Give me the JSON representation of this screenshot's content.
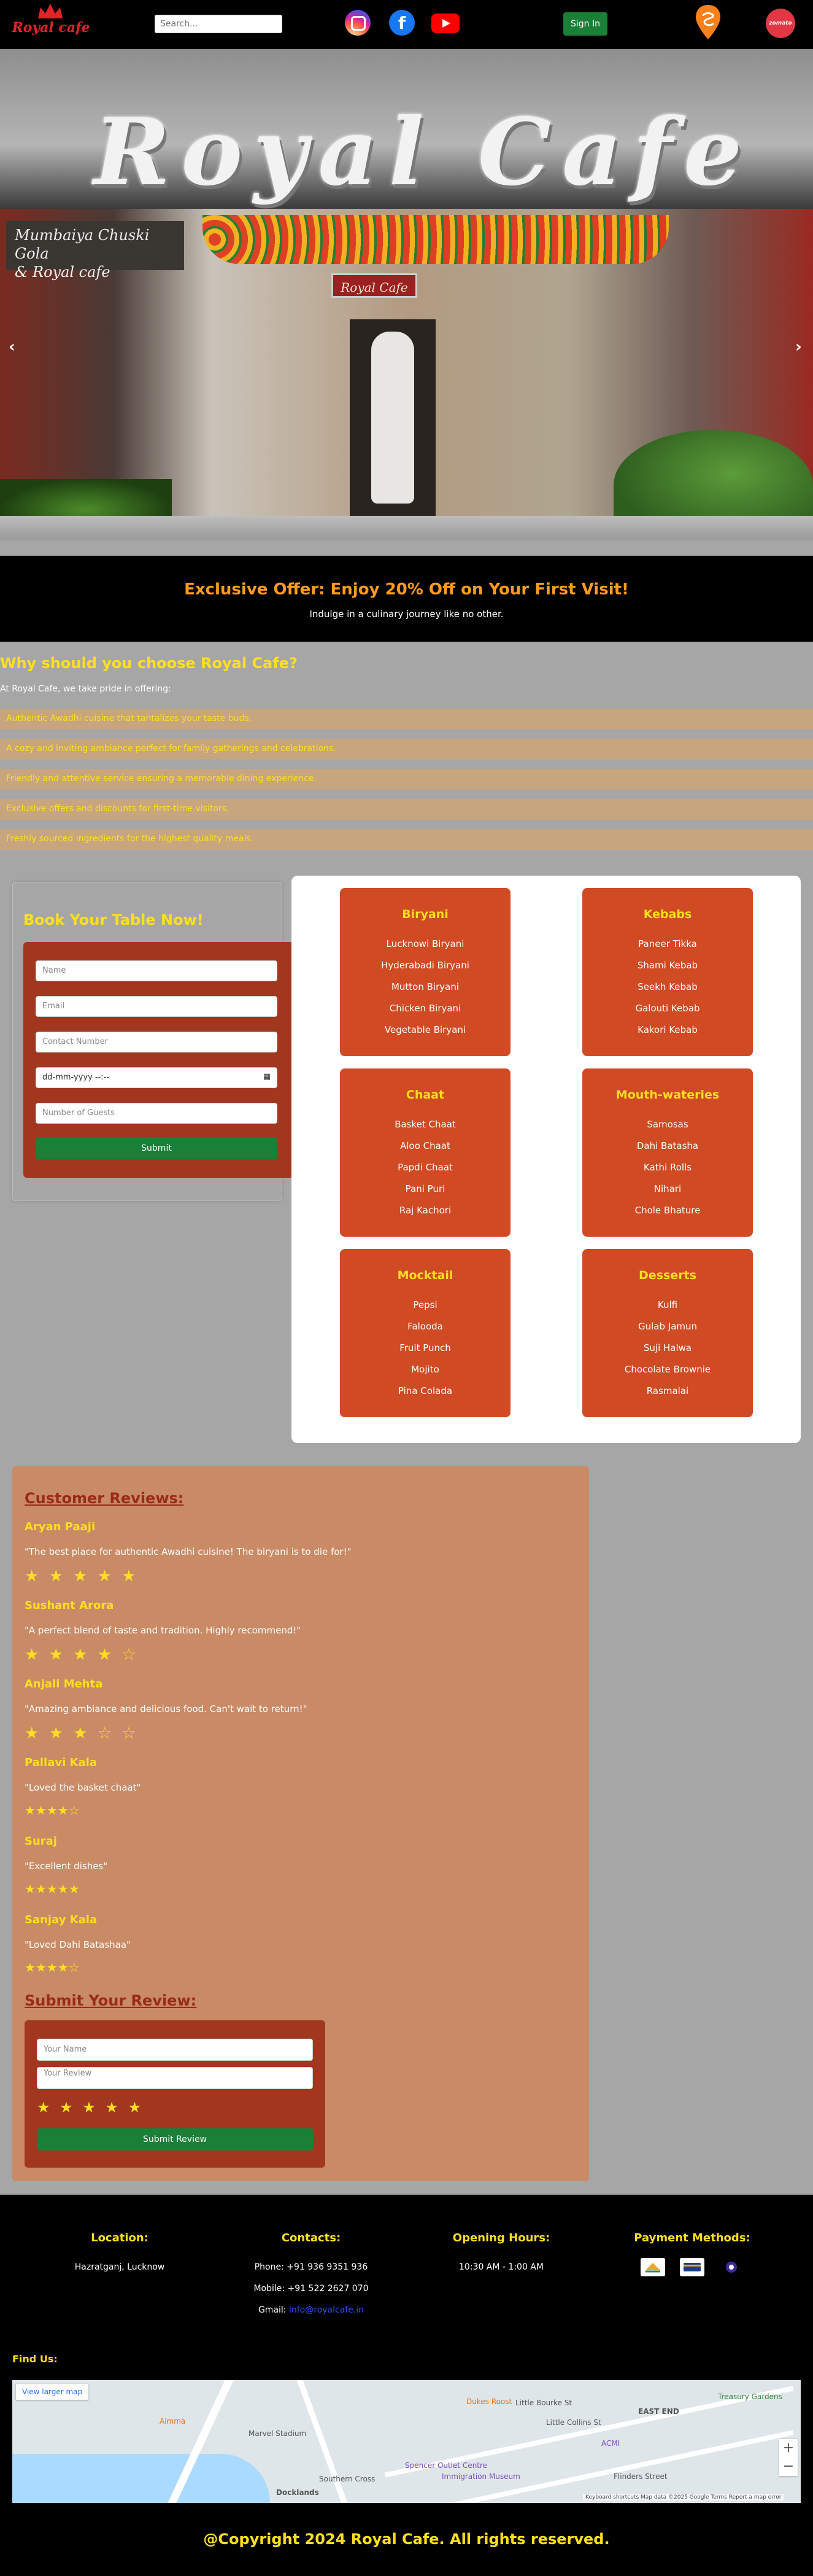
{
  "header": {
    "logo_text": "Royal cafe",
    "search_placeholder": "Search...",
    "signin_label": "Sign In",
    "zomato_label": "zomato"
  },
  "hero": {
    "title": "Royal Cafe",
    "shop_sign": "Royal Cafe",
    "side_sign_line1": "Mumbaiya Chuski Gola",
    "side_sign_line2": "& Royal cafe",
    "prev_arrow": "‹",
    "next_arrow": "›"
  },
  "offer": {
    "heading": "Exclusive Offer: Enjoy 20% Off on Your First Visit!",
    "subtext": "Indulge in a culinary journey like no other."
  },
  "why": {
    "title": "Why should you choose Royal Cafe?",
    "intro": "At Royal Cafe, we take pride in offering:",
    "items": [
      "Authentic Awadhi cuisine that tantalizes your taste buds.",
      "A cozy and inviting ambiance perfect for family gatherings and celebrations.",
      "Friendly and attentive service ensuring a memorable dining experience.",
      "Exclusive offers and discounts for first-time visitors.",
      "Freshly sourced ingredients for the highest quality meals."
    ]
  },
  "booking": {
    "title": "Book Your Table Now!",
    "name_placeholder": "Name",
    "email_placeholder": "Email",
    "contact_placeholder": "Contact Number",
    "datetime_placeholder": "dd-mm-yyyy  --:--",
    "guests_placeholder": "Number of Guests",
    "submit_label": "Submit"
  },
  "menu": [
    {
      "title": "Biryani",
      "items": [
        "Lucknowi Biryani",
        "Hyderabadi Biryani",
        "Mutton Biryani",
        "Chicken Biryani",
        "Vegetable Biryani"
      ]
    },
    {
      "title": "Kebabs",
      "items": [
        "Paneer Tikka",
        "Shami Kebab",
        "Seekh Kebab",
        "Galouti Kebab",
        "Kakori Kebab"
      ]
    },
    {
      "title": "Chaat",
      "items": [
        "Basket Chaat",
        "Aloo Chaat",
        "Papdi Chaat",
        "Pani Puri",
        "Raj Kachori"
      ]
    },
    {
      "title": "Mouth-wateries",
      "items": [
        "Samosas",
        "Dahi Batasha",
        "Kathi Rolls",
        "Nihari",
        "Chole Bhature"
      ]
    },
    {
      "title": "Mocktail",
      "items": [
        "Pepsi",
        "Falooda",
        "Fruit Punch",
        "Mojito",
        "Pina Colada"
      ]
    },
    {
      "title": "Desserts",
      "items": [
        "Kulfi",
        "Gulab Jamun",
        "Suji Halwa",
        "Chocolate Brownie",
        "Rasmalai"
      ]
    }
  ],
  "reviews": {
    "title": "Customer Reviews:",
    "list": [
      {
        "name": "Aryan Paaji",
        "text": "\"The best place for authentic Awadhi cuisine! The biryani is to die for!\"",
        "stars": "★ ★ ★ ★ ★",
        "rating": 5
      },
      {
        "name": "Sushant Arora",
        "text": "\"A perfect blend of taste and tradition. Highly recommend!\"",
        "stars": "★ ★ ★ ★ ☆",
        "rating": 4
      },
      {
        "name": "Anjali Mehta",
        "text": "\"Amazing ambiance and delicious food. Can't wait to return!\"",
        "stars": "★ ★ ★ ☆ ☆",
        "rating": 3
      },
      {
        "name": "Pallavi Kala",
        "text": "\"Loved the basket chaat\"",
        "stars": "★★★★☆",
        "rating": 4
      },
      {
        "name": "Suraj",
        "text": "\"Excellent dishes\"",
        "stars": "★★★★★",
        "rating": 5
      },
      {
        "name": "Sanjay Kala",
        "text": "\"Loved Dahi Batashaa\"",
        "stars": "★★★★☆",
        "rating": 4
      }
    ],
    "submit_title": "Submit Your Review:",
    "name_placeholder": "Your Name",
    "review_placeholder": "Your Review",
    "form_stars": "★ ★ ★ ★ ★",
    "submit_label": "Submit Review"
  },
  "footer": {
    "location_title": "Location:",
    "location_value": "Hazratganj, Lucknow",
    "contacts_title": "Contacts:",
    "phone": "Phone: +91 936 9351 936",
    "mobile": "Mobile: +91 522 2627 070",
    "gmail_label": "Gmail:",
    "gmail_link": "info@royalcafe.in",
    "hours_title": "Opening Hours:",
    "hours_value": "10:30 AM - 1:00 AM",
    "payment_title": "Payment Methods:",
    "find_us": "Find Us:",
    "map_link": "View larger map",
    "map_labels": [
      "EAST END",
      "Marvel Stadium",
      "Docklands",
      "Aimma",
      "Little Bourke St",
      "Little Collins St",
      "Flinders Street",
      "Spencer Outlet Centre",
      "Immigration Museum",
      "Southern Cross",
      "Treasury Gardens",
      "Dukes Roost",
      "ACMI"
    ],
    "map_attribution": "Keyboard shortcuts   Map data ©2025 Google   Terms   Report a map error",
    "copyright": "@Copyright 2024 Royal Cafe. All rights reserved."
  }
}
